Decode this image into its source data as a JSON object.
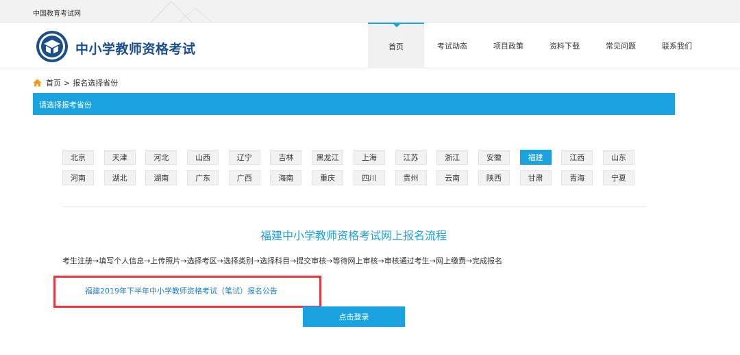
{
  "topbar": {
    "site_name": "中国教育考试网"
  },
  "header": {
    "title": "中小学教师资格考试"
  },
  "nav": [
    {
      "label": "首页",
      "active": true
    },
    {
      "label": "考试动态"
    },
    {
      "label": "项目政策"
    },
    {
      "label": "资料下载"
    },
    {
      "label": "常见问题"
    },
    {
      "label": "联系我们"
    }
  ],
  "breadcrumb": {
    "home": "首页",
    "separator": ">",
    "current": "报名选择省份"
  },
  "section": {
    "title": "请选择报考省份"
  },
  "provinces": {
    "selected": "福建",
    "row1": [
      "北京",
      "天津",
      "河北",
      "山西",
      "辽宁",
      "吉林",
      "黑龙江",
      "上海",
      "江苏",
      "浙江",
      "安徽",
      "福建",
      "江西",
      "山东"
    ],
    "row2": [
      "河南",
      "湖北",
      "湖南",
      "广东",
      "广西",
      "海南",
      "重庆",
      "四川",
      "贵州",
      "云南",
      "陕西",
      "甘肃",
      "青海",
      "宁夏"
    ]
  },
  "flow": {
    "title": "福建中小学教师资格考试网上报名流程",
    "steps": "考生注册→填写个人信息→上传照片→选择考区→选择类别→选择科目→提交审核→等待网上审核→审核通过考生→网上缴费→完成报名"
  },
  "notice": {
    "link": "福建2019年下半年中小学教师资格考试（笔试）报名公告"
  },
  "login": {
    "label": "点击登录"
  },
  "colors": {
    "accent": "#1aa3e0",
    "highlight": "#e8383d",
    "brand": "#1a4f8c"
  }
}
